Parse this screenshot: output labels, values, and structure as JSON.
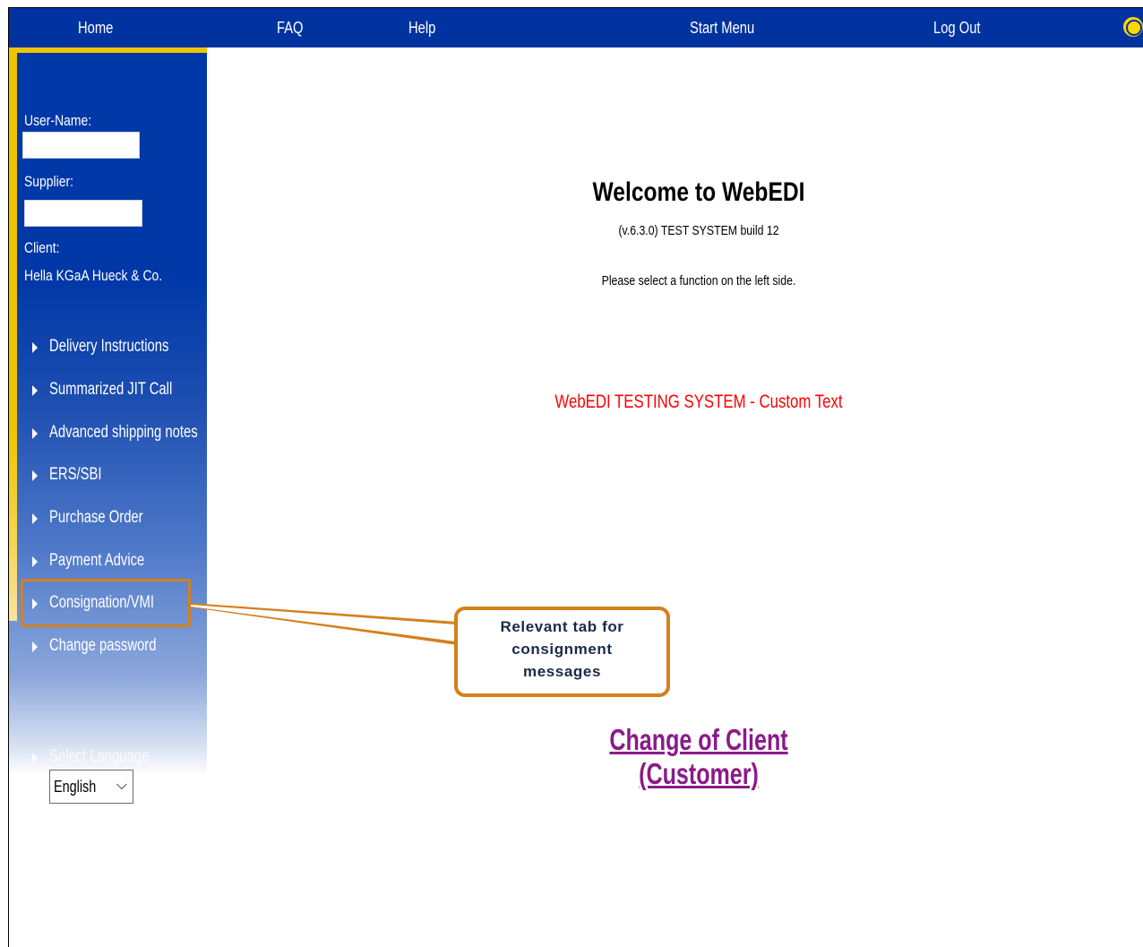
{
  "topnav": {
    "home": "Home",
    "faq": "FAQ",
    "help": "Help",
    "start_menu": "Start Menu",
    "log_out": "Log Out"
  },
  "sidebar": {
    "username_label": "User-Name:",
    "username_value": "",
    "supplier_label": "Supplier:",
    "supplier_value": "",
    "client_label": "Client:",
    "client_value": "Hella KGaA Hueck & Co.",
    "menu": [
      {
        "label": "Delivery Instructions"
      },
      {
        "label": "Summarized JIT Call"
      },
      {
        "label": "Advanced shipping notes"
      },
      {
        "label": "ERS/SBI"
      },
      {
        "label": "Purchase Order"
      },
      {
        "label": "Payment Advice"
      },
      {
        "label": "Consignation/VMI"
      },
      {
        "label": "Change password"
      }
    ],
    "select_language_label": "Select Language",
    "language_value": "English"
  },
  "main": {
    "welcome_title": "Welcome to WebEDI",
    "version": "(v.6.3.0) TEST SYSTEM build 12",
    "instruction": "Please select a function on the left side.",
    "custom_text": "WebEDI TESTING SYSTEM - Custom Text",
    "change_client_link": "Change of Client (Customer)"
  },
  "callout": {
    "line1": "Relevant tab for",
    "line2": "consignment",
    "line3": "messages"
  },
  "colors": {
    "nav_blue": "#0033a0",
    "accent_yellow": "#f0c400",
    "callout_orange": "#d4801c",
    "custom_text_red": "#ff0000",
    "link_purple": "#8b1a89"
  }
}
